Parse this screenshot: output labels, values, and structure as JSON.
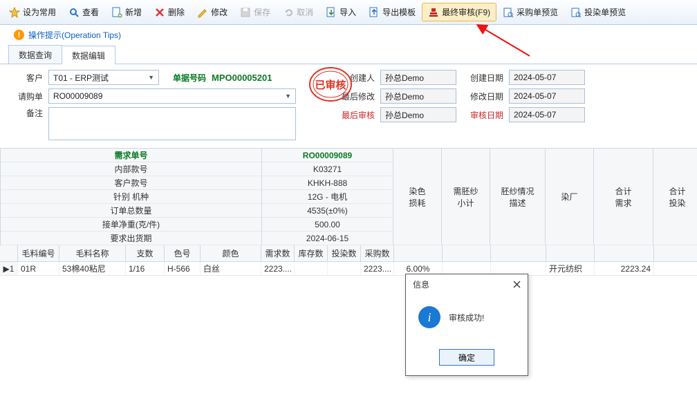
{
  "toolbar": {
    "set_default": "设为常用",
    "view": "查看",
    "new": "新增",
    "delete": "删除",
    "edit": "修改",
    "save": "保存",
    "cancel": "取消",
    "import": "导入",
    "export_tpl": "导出模板",
    "final_audit": "最终审核(F9)",
    "po_preview": "采购单预览",
    "dye_preview": "投染单预览"
  },
  "tips": {
    "label": "操作提示(Operation Tips)"
  },
  "tabs": {
    "query": "数据查询",
    "edit": "数据编辑"
  },
  "form": {
    "customer_label": "客户",
    "customer_value": "T01 - ERP测试",
    "docno_label": "单据号码",
    "docno_value": "MPO00005201",
    "creator_label": "创建人",
    "creator_value": "孙总Demo",
    "create_date_label": "创建日期",
    "create_date_value": "2024-05-07",
    "request_label": "请购单",
    "request_value": "RO00009089",
    "lastmod_label": "最后修改",
    "lastmod_value": "孙总Demo",
    "mod_date_label": "修改日期",
    "mod_date_value": "2024-05-07",
    "remark_label": "备注",
    "lastaudit_label": "最后审核",
    "lastaudit_value": "孙总Demo",
    "audit_date_label": "审核日期",
    "audit_date_value": "2024-05-07"
  },
  "stamp_text": "已审核",
  "kv": {
    "k0": "需求单号",
    "v0": "RO00009089",
    "k1": "内部款号",
    "v1": "K03271",
    "k2": "客户款号",
    "v2": "KHKH-888",
    "k3": "针别 机种",
    "v3": "12G - 电机",
    "k4": "订单总数量",
    "v4": "4535(±0%)",
    "k5": "接单净重(克/件)",
    "v5": "500.00",
    "k6": "要求出货期",
    "v6": "2024-06-15"
  },
  "tall_cols": [
    "染色\n损耗",
    "需胚纱\n小计",
    "胚纱情况\n描述",
    "染厂",
    "合计\n需求",
    "合计\n投染"
  ],
  "small_cols": {
    "c0": "毛料编号",
    "c1": "毛料名称",
    "c2": "支数",
    "c3": "色号",
    "c4": "颜色",
    "c5": "需求数",
    "c6": "库存数",
    "c7": "投染数",
    "c8": "采购数"
  },
  "row": {
    "idx": "▶1",
    "code": "01R",
    "name": "53棉40粘尼",
    "count": "1/16",
    "colno": "H-566",
    "color": "白丝",
    "need": "2223....",
    "stock": "",
    "dye": "",
    "buy": "2223....",
    "loss": "6.00%",
    "sub": "",
    "desc": "",
    "factory": "开元纺织",
    "total_need": "2223.24",
    "total_dye": ""
  },
  "dialog": {
    "title": "信息",
    "msg": "审核成功!",
    "ok": "确定"
  }
}
